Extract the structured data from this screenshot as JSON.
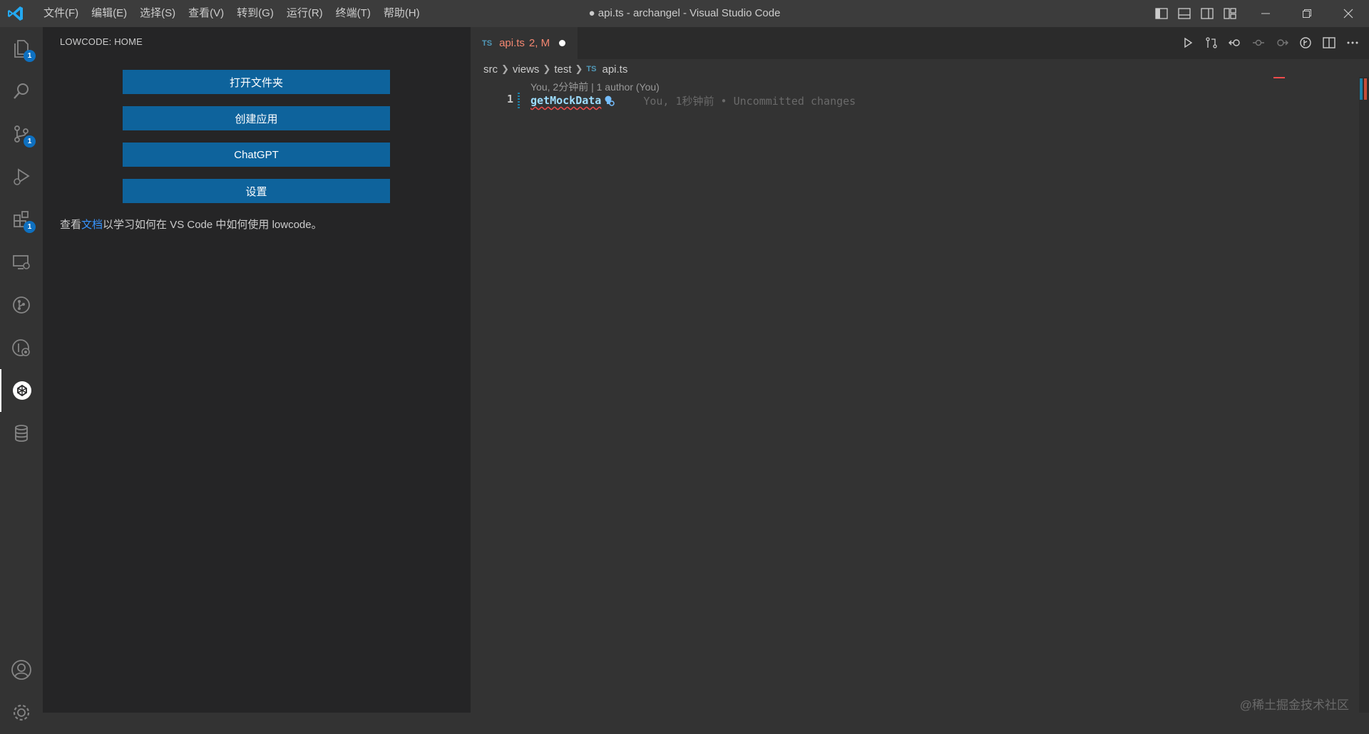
{
  "titlebar": {
    "window_title": "● api.ts - archangel - Visual Studio Code",
    "menu": [
      "文件(F)",
      "编辑(E)",
      "选择(S)",
      "查看(V)",
      "转到(G)",
      "运行(R)",
      "终端(T)",
      "帮助(H)"
    ]
  },
  "activitybar": {
    "badges": {
      "explorer": "1",
      "source_control": "1",
      "extensions": "1"
    }
  },
  "sidebar": {
    "title": "LOWCODE: HOME",
    "buttons": [
      "打开文件夹",
      "创建应用",
      "ChatGPT",
      "设置"
    ],
    "doc_prefix": "查看",
    "doc_link": "文档",
    "doc_suffix": "以学习如何在 VS Code 中如何使用 lowcode。"
  },
  "editor": {
    "tab": {
      "lang": "TS",
      "name": "api.ts",
      "status": "2, M"
    },
    "breadcrumb": [
      "src",
      "views",
      "test",
      "api.ts"
    ],
    "breadcrumb_lang": "TS",
    "codelens": "You, 2分钟前 | 1 author (You)",
    "line_number": "1",
    "code": "getMockData",
    "blame": "You, 1秒钟前 • Uncommitted changes"
  },
  "watermark": "@稀土掘金技术社区",
  "colors": {
    "accent": "#0e639c",
    "badge": "#0e70c0",
    "link": "#3794ff",
    "modified": "#f48771",
    "error": "#f14c4c"
  }
}
